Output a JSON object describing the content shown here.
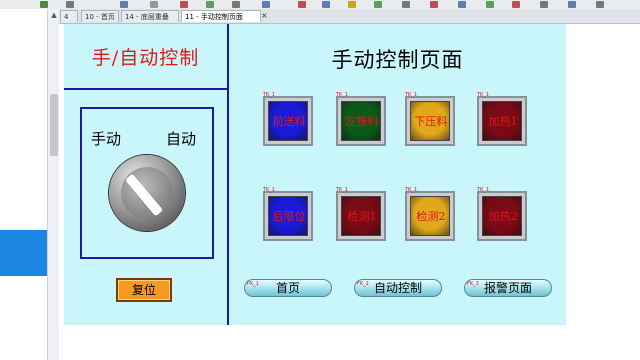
{
  "tabs": [
    {
      "label": "4",
      "active": false
    },
    {
      "label": "10 - 首页",
      "active": false
    },
    {
      "label": "14 - 底层重叠",
      "active": false
    },
    {
      "label": "11 - 手动控制页面",
      "active": true
    }
  ],
  "tab_close_glyph": "×",
  "left_panel": {
    "title": "手/自动控制",
    "switch_left_label": "手动",
    "switch_right_label": "自动",
    "switch_position": "manual",
    "reset_label": "复位"
  },
  "page_title": "手动控制页面",
  "lamps": [
    {
      "label": "前送料",
      "tag": "TK_1",
      "color": "#1a1ad8"
    },
    {
      "label": "左推料",
      "tag": "TK_1",
      "color": "#0b5a1a"
    },
    {
      "label": "下压料",
      "tag": "TK_1",
      "color": "#e0a81a"
    },
    {
      "label": "加热1",
      "tag": "TK_1",
      "color": "#7a0a16"
    },
    {
      "label": "后限位",
      "tag": "TK_1",
      "color": "#1a1ad8"
    },
    {
      "label": "检测1",
      "tag": "TK_1",
      "color": "#7a0a16"
    },
    {
      "label": "检测2",
      "tag": "TK_1",
      "color": "#e0a81a"
    },
    {
      "label": "加热2",
      "tag": "TK_1",
      "color": "#7a0a16"
    }
  ],
  "nav_buttons": [
    {
      "label": "首页",
      "tag": "FK_1"
    },
    {
      "label": "自动控制",
      "tag": "FK_2"
    },
    {
      "label": "报警页面",
      "tag": "FK_3"
    }
  ],
  "colors": {
    "screen_bg": "#c8f6fa",
    "divider": "#1a1aa8",
    "title_red": "#e01818",
    "reset_orange": "#f49a1e",
    "dock_blue": "#1c86e3"
  }
}
